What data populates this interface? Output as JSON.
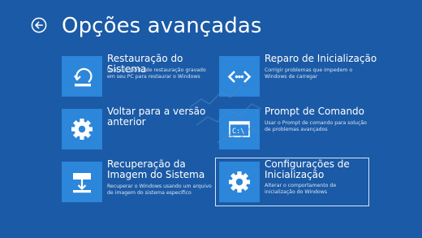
{
  "page": {
    "title": "Opções avançadas",
    "background_color": "#1b5aa6",
    "tile_color": "#2c86da"
  },
  "back_button": {
    "icon": "back-arrow-circle-icon"
  },
  "options": [
    {
      "id": "system-restore",
      "icon": "restore-icon",
      "title": "Restauração do Sistema",
      "description": "Usar um ponto de restauração gravado em seu PC para restaurar o Windows"
    },
    {
      "id": "startup-repair",
      "icon": "code-brackets-icon",
      "title": "Reparo de Inicialização",
      "description": "Corrigir problemas que impedem o Windows de carregar"
    },
    {
      "id": "go-back",
      "icon": "gear-icon",
      "title": "Voltar para a versão anterior",
      "description": ""
    },
    {
      "id": "command-prompt",
      "icon": "command-prompt-icon",
      "title": "Prompt de Comando",
      "description": "Usar o Prompt de comando para solução de problemas avançados"
    },
    {
      "id": "system-image-recovery",
      "icon": "system-image-icon",
      "title": "Recuperação da Imagem do Sistema",
      "description": "Recuperar o Windows usando um arquivo de imagem do sistema específico"
    },
    {
      "id": "startup-settings",
      "icon": "gear-icon",
      "title": "Configurações de Inicialização",
      "description": "Alterar o comportamento de inicialização do Windows",
      "selected": true
    }
  ]
}
